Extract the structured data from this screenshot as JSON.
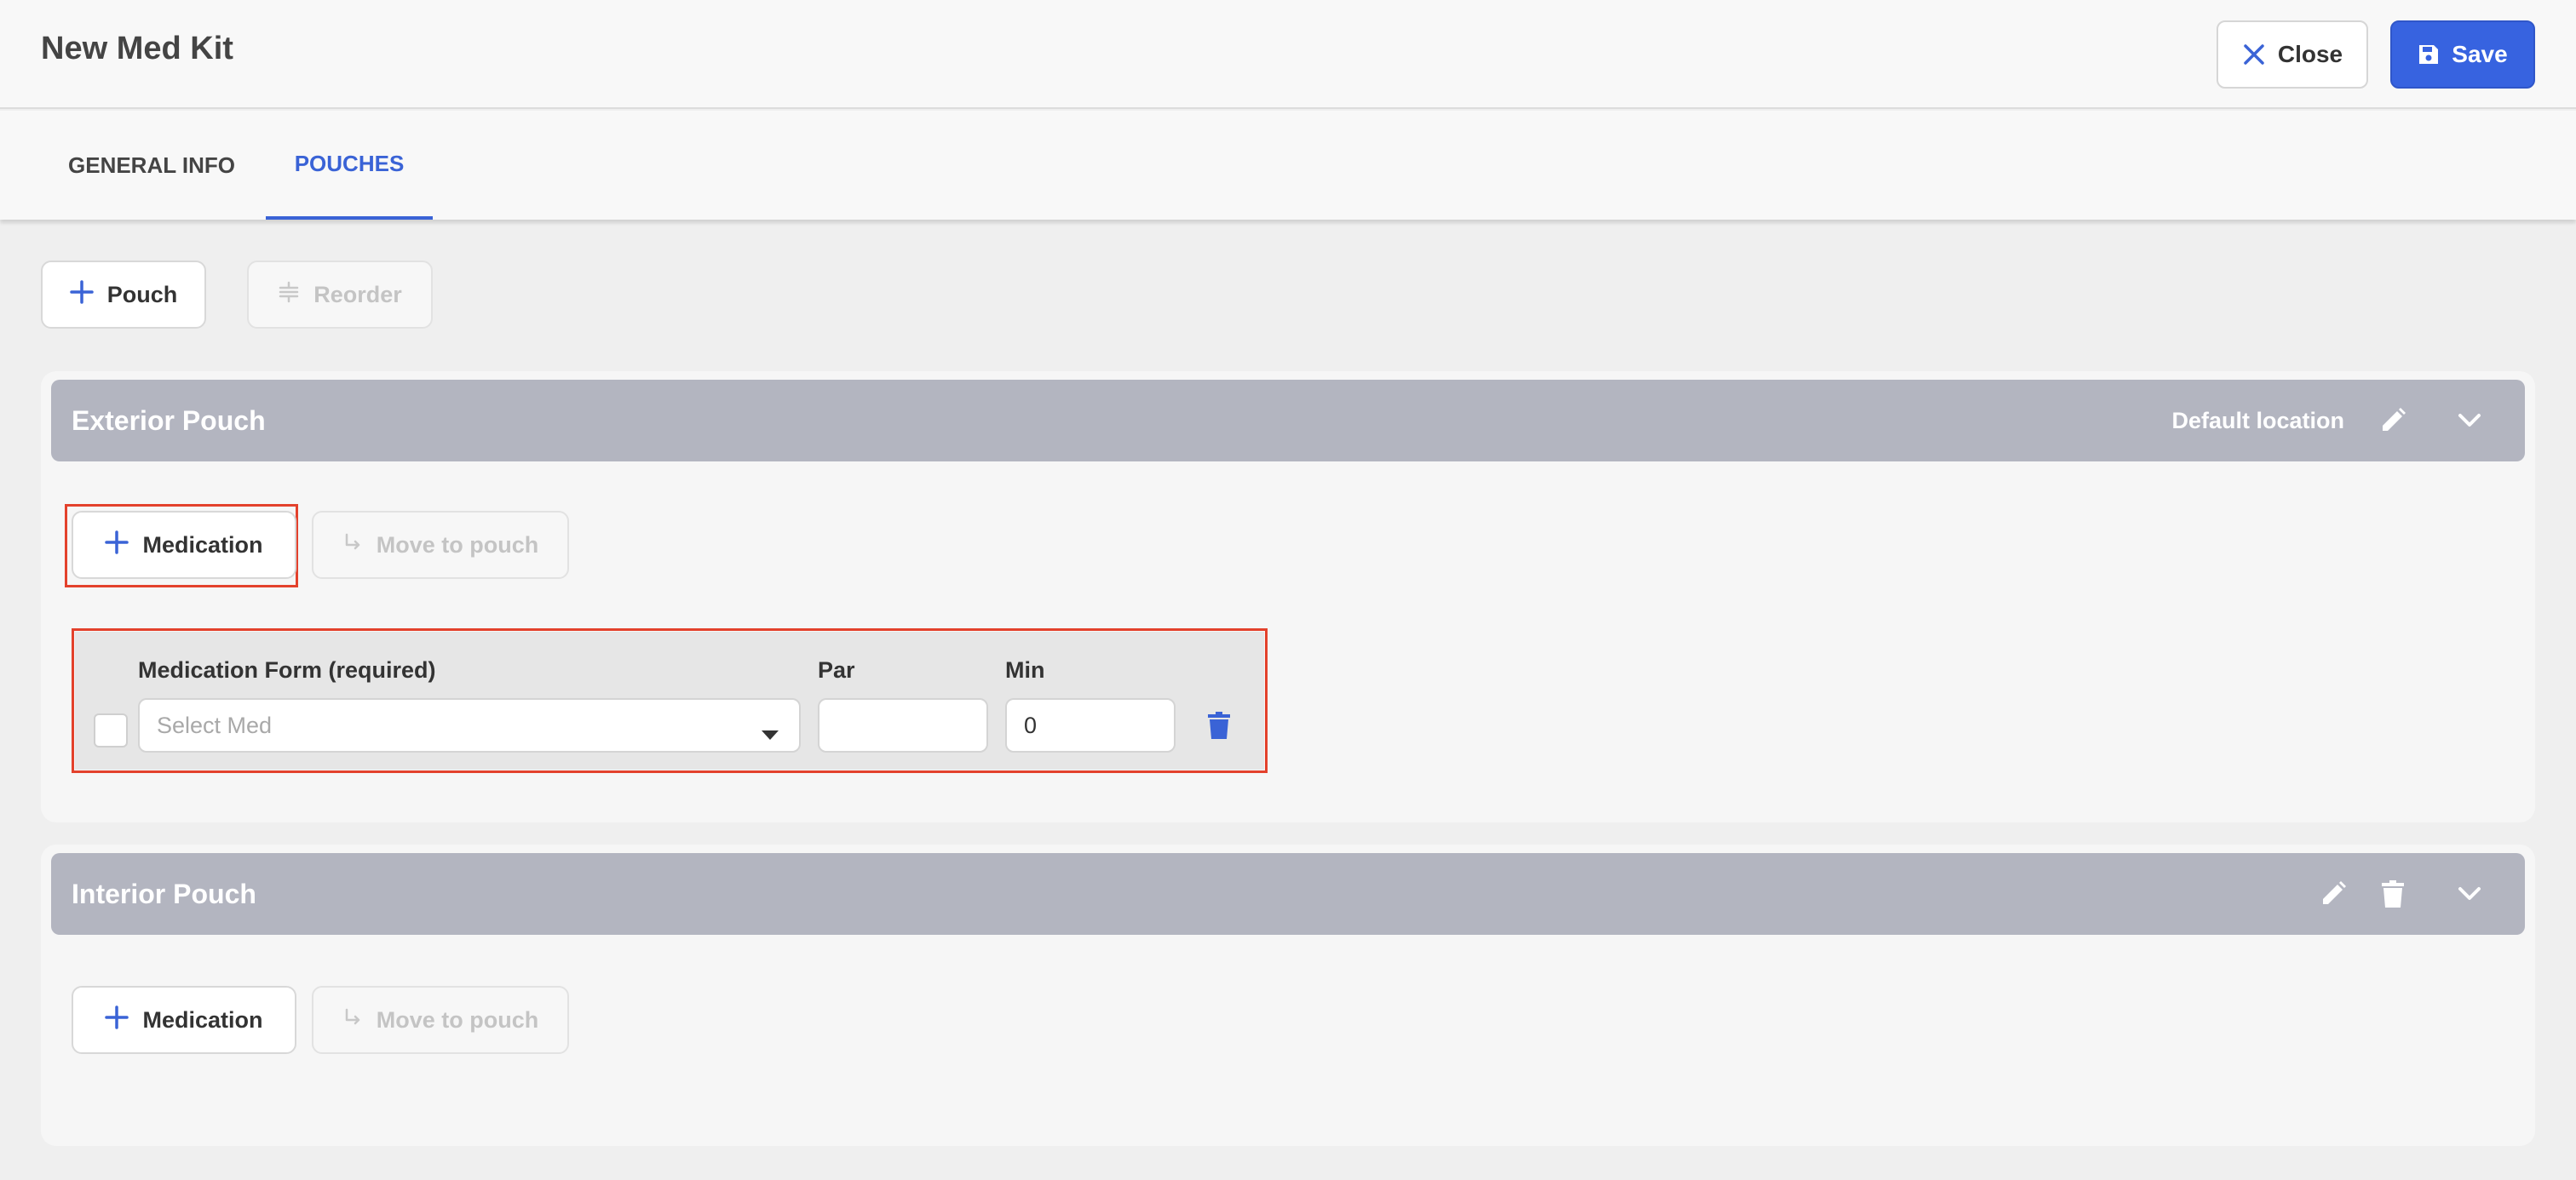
{
  "header": {
    "title": "New Med Kit",
    "close_label": "Close",
    "save_label": "Save"
  },
  "tabs": [
    {
      "label": "GENERAL INFO",
      "active": false
    },
    {
      "label": "POUCHES",
      "active": true
    }
  ],
  "toolbar": {
    "add_pouch_label": "Pouch",
    "reorder_label": "Reorder"
  },
  "pouches": [
    {
      "name": "Exterior Pouch",
      "default_location_label": "Default location",
      "add_medication_label": "Medication",
      "move_to_pouch_label": "Move to pouch",
      "medications": [
        {
          "form_label": "Medication Form (required)",
          "form_placeholder": "Select Med",
          "par_label": "Par",
          "par_value": "",
          "min_label": "Min",
          "min_value": "0"
        }
      ]
    },
    {
      "name": "Interior Pouch",
      "add_medication_label": "Medication",
      "move_to_pouch_label": "Move to pouch"
    }
  ],
  "colors": {
    "accent": "#3763e0",
    "pouch_header": "#b3b5c0",
    "highlight": "#e3412c",
    "delete_icon": "#3a63d6"
  },
  "icons": [
    "close-icon",
    "save-icon",
    "plus-icon",
    "reorder-icon",
    "move-arrow-icon",
    "pencil-icon",
    "chevron-down-icon",
    "trash-icon",
    "caret-down-icon"
  ]
}
